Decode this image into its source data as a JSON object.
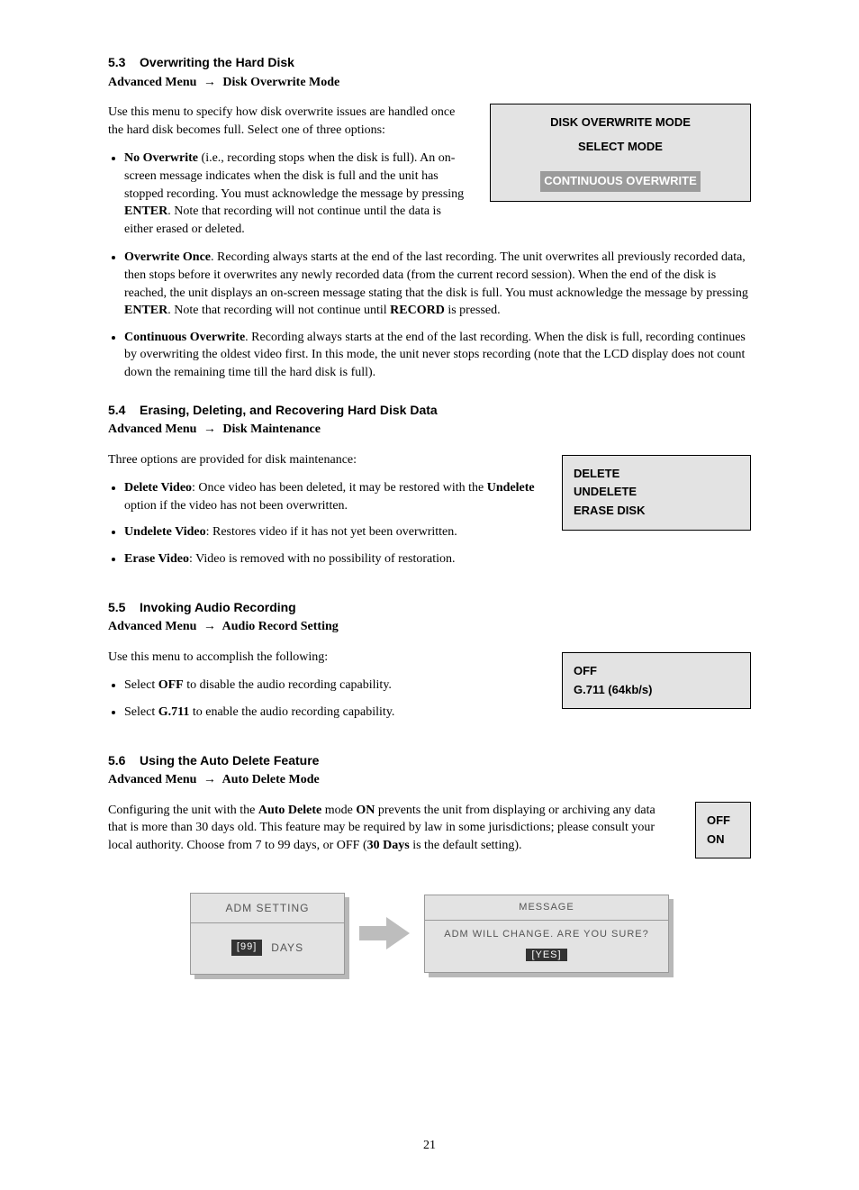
{
  "page_number": "21",
  "sections": {
    "s53": {
      "num": "5.3",
      "title": "Overwriting the Hard Disk",
      "breadcrumb_a": "Advanced Menu",
      "breadcrumb_b": "Disk Overwrite Mode",
      "intro": "Use this menu to specify how disk overwrite issues are handled once the hard disk becomes full. Select one of three options:",
      "b1_label": "No Overwrite",
      "b1_pre": " (i.e., recording stops when the disk is full). An on-screen message indicates when the disk is full and the unit has stopped recording. You must acknowledge the message by pressing ",
      "b1_enter": "ENTER",
      "b1_post": ". Note that recording will not continue until the data is either erased or deleted.",
      "b2_label": "Overwrite Once",
      "b2_pre": ". Recording always starts at the end of the last recording. The unit overwrites all previously recorded data, then stops before it overwrites any newly recorded data (from the current record session). When the end of the disk is reached, the unit displays an on-screen message stating that the disk is full. You must acknowledge the message by pressing ",
      "b2_enter": "ENTER",
      "b2_mid": ". Note that recording will not continue until ",
      "b2_record": "RECORD",
      "b2_end": " is pressed.",
      "b3_label": "Continuous Overwrite",
      "b3_text": ". Recording always starts at the end of the last recording. When the disk is full, recording continues by overwriting the oldest video first. In this mode, the unit never stops recording (note that the LCD display does not count down the remaining time till the hard disk is full).",
      "menu": {
        "line1": "DISK OVERWRITE MODE",
        "line2": "SELECT MODE",
        "line3": "CONTINUOUS OVERWRITE"
      }
    },
    "s54": {
      "num": "5.4",
      "title": "Erasing, Deleting, and Recovering Hard Disk Data",
      "breadcrumb_a": "Advanced Menu",
      "breadcrumb_b": "Disk Maintenance",
      "intro": "Three options are provided for disk maintenance:",
      "b1_label": "Delete Video",
      "b1_pre": ": Once video has been deleted, it may be restored with the ",
      "b1_undelete": "Undelete",
      "b1_post": " option if the video has not been overwritten.",
      "b2_label": "Undelete Video",
      "b2_text": ": Restores video if it has not yet been overwritten.",
      "b3_label": "Erase Video",
      "b3_text": ": Video is removed with no possibility of restoration.",
      "menu": {
        "line1": "DELETE",
        "line2": "UNDELETE",
        "line3": "ERASE DISK"
      }
    },
    "s55": {
      "num": "5.5",
      "title": "Invoking Audio Recording",
      "breadcrumb_a": "Advanced Menu",
      "breadcrumb_b": "Audio Record Setting",
      "intro": "Use this menu to accomplish the following:",
      "b1_pre": "Select ",
      "b1_off": "OFF",
      "b1_post": " to disable the audio recording capability.",
      "b2_pre": "Select ",
      "b2_g711": "G.711",
      "b2_post": " to enable the audio recording capability.",
      "menu": {
        "line1": "OFF",
        "line2": "G.711 (64kb/s)"
      }
    },
    "s56": {
      "num": "5.6",
      "title": "Using the Auto Delete Feature",
      "breadcrumb_a": "Advanced Menu",
      "breadcrumb_b": "Auto Delete Mode",
      "p_pre": "Configuring the unit with the ",
      "p_ad": "Auto Delete",
      "p_mid1": " mode ",
      "p_on": "ON",
      "p_mid2": " prevents the unit from displaying or archiving any data that is more than 30 days old. This feature may be required by law in some jurisdictions; please consult your local authority. Choose from 7 to 99 days, or OFF (",
      "p_30": "30 Days",
      "p_end": " is the default setting).",
      "menu": {
        "line1": "OFF",
        "line2": "ON"
      },
      "lcd_adm_title": "ADM  SETTING",
      "lcd_adm_value": "[99]",
      "lcd_adm_unit": "DAYS",
      "lcd_msg_title": "MESSAGE",
      "lcd_msg_text": "ADM  WILL CHANGE.  ARE YOU SURE?",
      "lcd_msg_yes": "[YES]"
    }
  }
}
